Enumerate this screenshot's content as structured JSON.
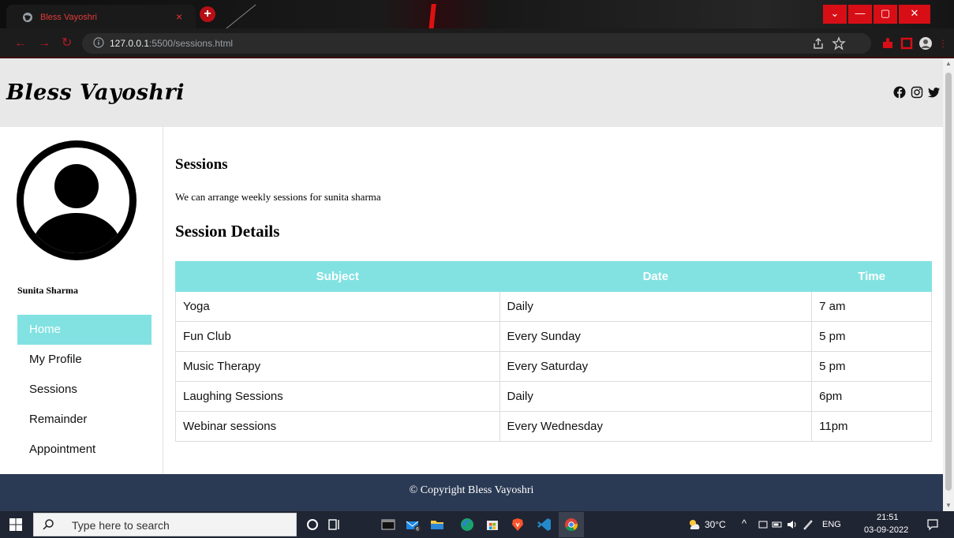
{
  "browser": {
    "tab_title": "Bless Vayoshri",
    "tab_close": "×",
    "new_tab": "+",
    "url_host": "127.0.0.1",
    "url_path": ":5500/sessions.html",
    "window_controls": {
      "dropdown": "⌄",
      "minimize": "—",
      "maximize": "▢",
      "close": "✕"
    }
  },
  "site": {
    "logo": "Bless Vayoshri",
    "social_icons": [
      "facebook-icon",
      "instagram-icon",
      "twitter-icon"
    ]
  },
  "sidebar": {
    "user_name": "Sunita Sharma",
    "nav_items": [
      {
        "label": "Home",
        "active": true
      },
      {
        "label": "My Profile"
      },
      {
        "label": "Sessions"
      },
      {
        "label": "Remainder"
      },
      {
        "label": "Appointment"
      }
    ]
  },
  "main": {
    "heading": "Sessions",
    "intro": "We can arrange weekly sessions for sunita sharma",
    "details_heading": "Session Details",
    "table": {
      "headers": [
        "Subject",
        "Date",
        "Time"
      ],
      "rows": [
        [
          "Yoga",
          "Daily",
          "7 am"
        ],
        [
          "Fun Club",
          "Every Sunday",
          "5 pm"
        ],
        [
          "Music Therapy",
          "Every Saturday",
          "5 pm"
        ],
        [
          "Laughing Sessions",
          "Daily",
          "6pm"
        ],
        [
          "Webinar sessions",
          "Every Wednesday",
          "11pm"
        ]
      ]
    }
  },
  "footer": {
    "text": "© Copyright Bless Vayoshri"
  },
  "taskbar": {
    "search_placeholder": "Type here to search",
    "temperature": "30°C",
    "language": "ENG",
    "time": "21:51",
    "date": "03-09-2022",
    "mail_badge": "6"
  },
  "colors": {
    "accent": "#82e2e2",
    "footer": "#2b3a54",
    "header": "#e8e8e8",
    "browser_red": "#d80e16"
  }
}
